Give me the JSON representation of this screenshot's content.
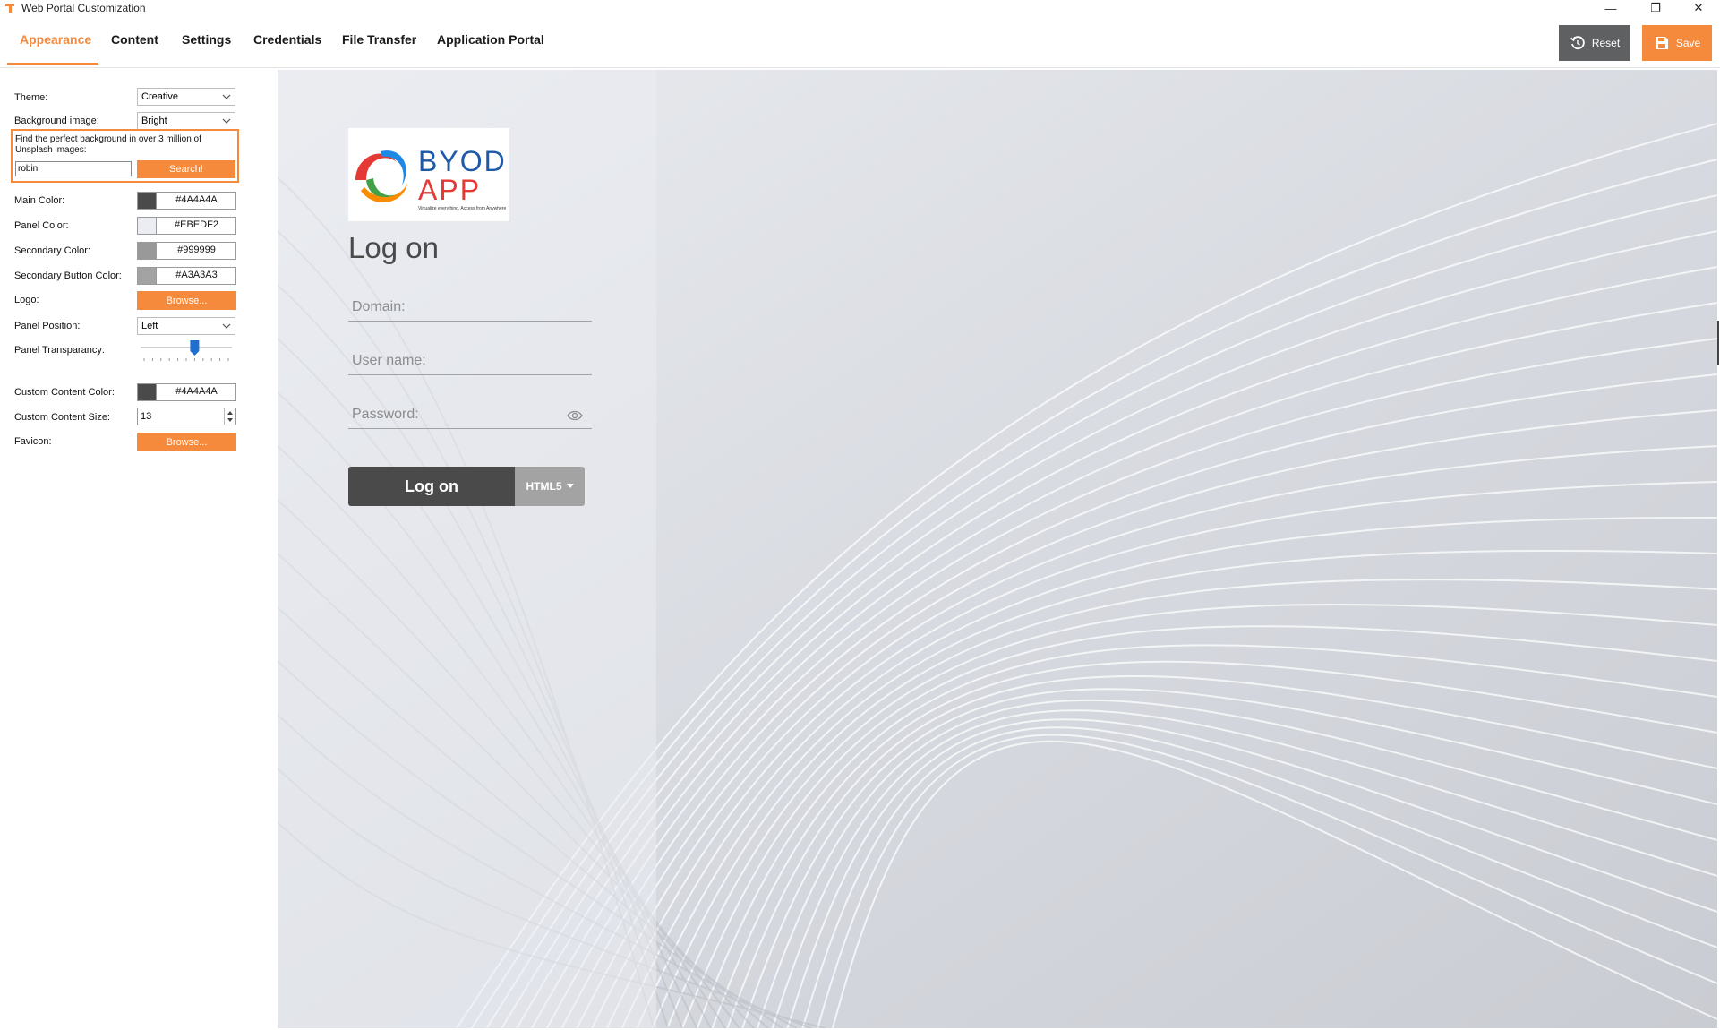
{
  "window": {
    "title": "Web Portal Customization",
    "minimize": "—",
    "maximize": "❐",
    "close": "✕"
  },
  "tabs": [
    {
      "label": "Appearance",
      "active": true
    },
    {
      "label": "Content"
    },
    {
      "label": "Settings"
    },
    {
      "label": "Credentials"
    },
    {
      "label": "File Transfer"
    },
    {
      "label": "Application Portal"
    }
  ],
  "toolbar": {
    "reset_label": "Reset",
    "save_label": "Save"
  },
  "settings": {
    "theme": {
      "label": "Theme:",
      "value": "Creative"
    },
    "background_image": {
      "label": "Background image:",
      "value": "Bright"
    },
    "unsplash": {
      "text": "Find the perfect background in over 3 million of Unsplash images:",
      "query": "robin",
      "button": "Search!"
    },
    "main_color": {
      "label": "Main Color:",
      "value": "#4A4A4A"
    },
    "panel_color": {
      "label": "Panel Color:",
      "value": "#EBEDF2"
    },
    "secondary_color": {
      "label": "Secondary Color:",
      "value": "#999999"
    },
    "secondary_button_color": {
      "label": "Secondary Button Color:",
      "value": "#A3A3A3"
    },
    "logo": {
      "label": "Logo:",
      "button": "Browse..."
    },
    "panel_position": {
      "label": "Panel Position:",
      "value": "Left"
    },
    "panel_transparency": {
      "label": "Panel Transparancy:",
      "level_percent": 60
    },
    "custom_content_color": {
      "label": "Custom Content Color:",
      "value": "#4A4A4A"
    },
    "custom_content_size": {
      "label": "Custom Content Size:",
      "value": "13"
    },
    "favicon": {
      "label": "Favicon:",
      "button": "Browse..."
    }
  },
  "preview": {
    "logo": {
      "line1": "BYOD",
      "line2": "APP",
      "tagline": "Virtualize everything. Access from Anywhere"
    },
    "title": "Log on",
    "domain_placeholder": "Domain:",
    "username_placeholder": "User name:",
    "password_placeholder": "Password:",
    "logon_button": "Log on",
    "mode_button": "HTML5"
  },
  "colors": {
    "accent": "#f58a3c",
    "reset_bg": "#5f6062"
  }
}
